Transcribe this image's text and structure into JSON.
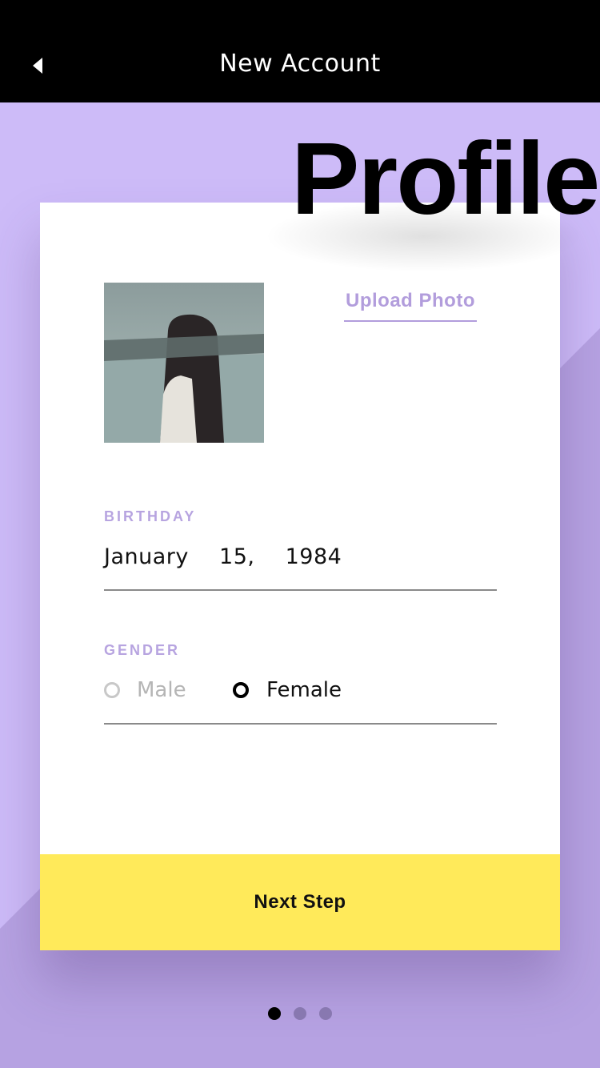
{
  "header": {
    "title": "New Account",
    "back_icon": "back-arrow-icon"
  },
  "page": {
    "heading": "Profile"
  },
  "profile": {
    "photo_icon": "profile-photo",
    "upload_label": "Upload Photo"
  },
  "birthday": {
    "label": "BIRTHDAY",
    "value": "January  15,  1984"
  },
  "gender": {
    "label": "GENDER",
    "options": [
      {
        "label": "Male",
        "selected": false
      },
      {
        "label": "Female",
        "selected": true
      }
    ]
  },
  "actions": {
    "next_label": "Next Step"
  },
  "pagination": {
    "total": 3,
    "current": 1
  },
  "colors": {
    "background": "#cdbbf8",
    "accent": "#b29ddc",
    "button": "#ffea5a",
    "header": "#000000"
  }
}
